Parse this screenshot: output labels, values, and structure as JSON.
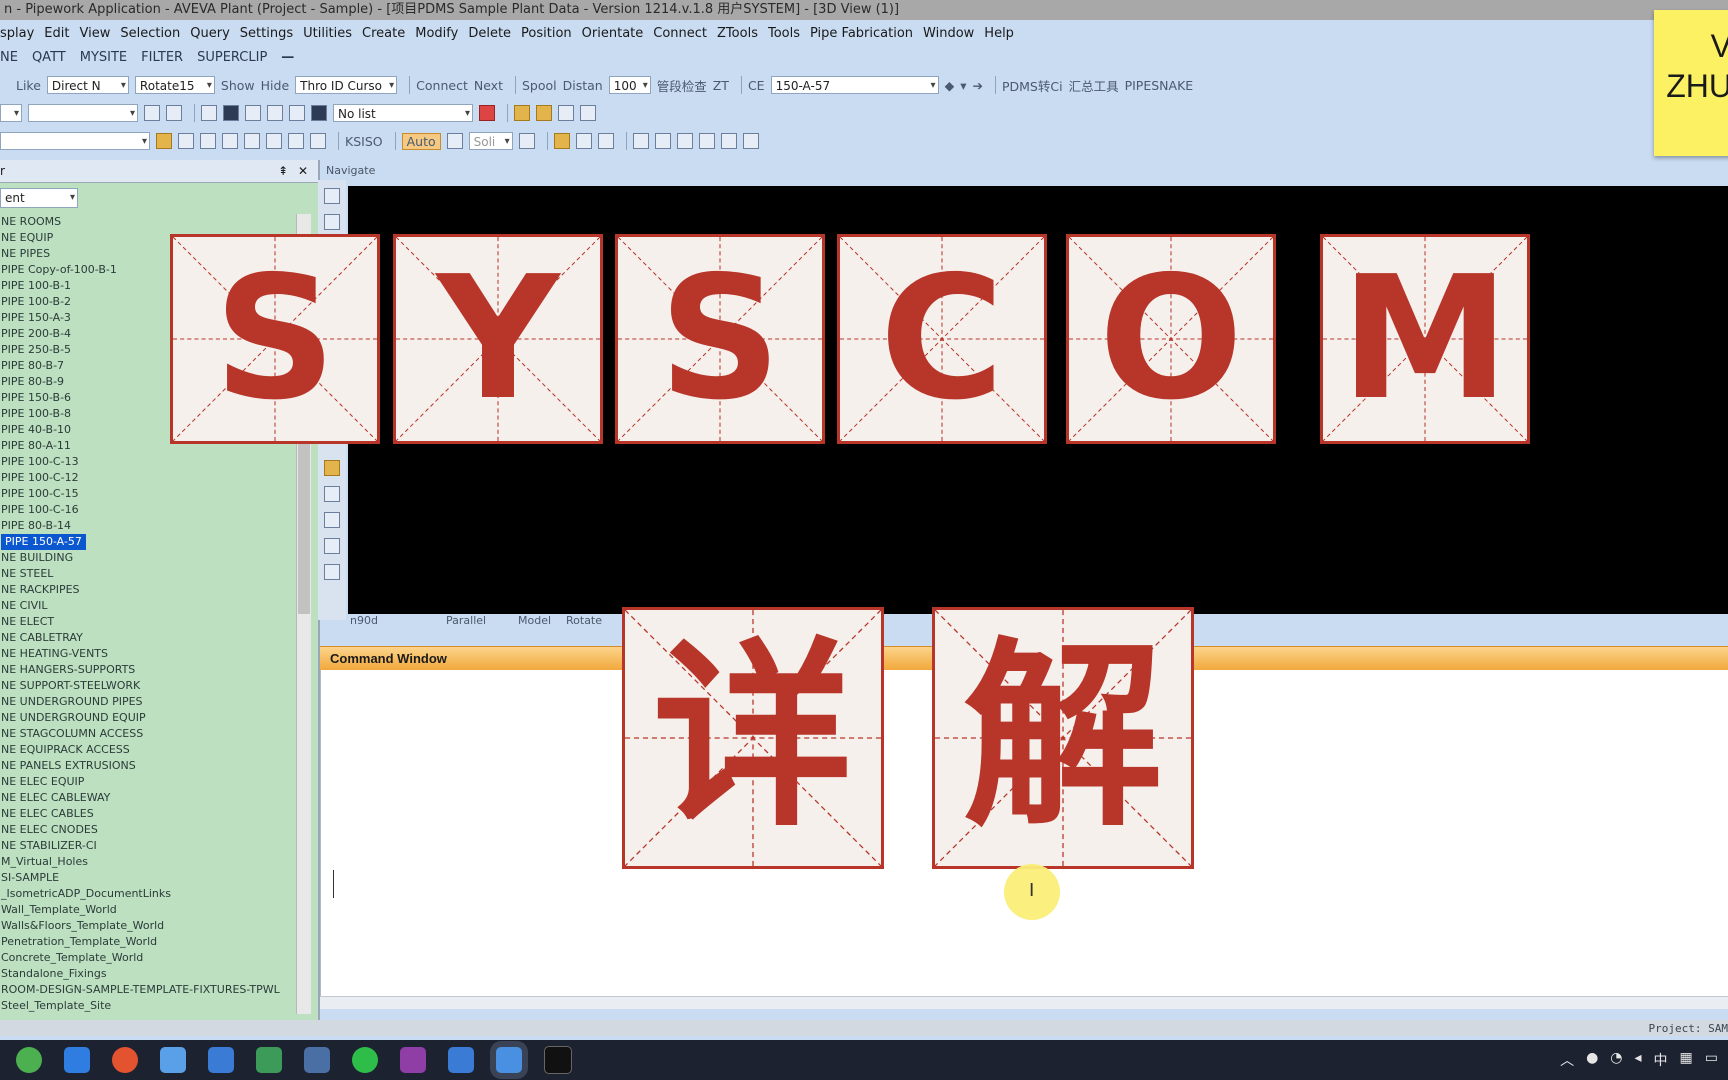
{
  "window": {
    "title": "n - Pipework Application - AVEVA Plant (Project - Sample) - [项目PDMS Sample Plant Data - Version 1214.v.1.8 用户SYSTEM] - [3D View (1)]"
  },
  "menubar": {
    "items": [
      "splay",
      "Edit",
      "View",
      "Selection",
      "Query",
      "Settings",
      "Utilities",
      "Create",
      "Modify",
      "Delete",
      "Position",
      "Orientate",
      "Connect",
      "ZTools",
      "Tools",
      "Pipe Fabrication",
      "Window",
      "Help"
    ]
  },
  "custombar": {
    "items": [
      "NE",
      "QATT",
      "MYSITE",
      "FILTER",
      "SUPERCLIP"
    ]
  },
  "toolbar1": {
    "like": "Like",
    "direct": "Direct N",
    "rotate": "Rotate15",
    "show": "Show",
    "hide": "Hide",
    "thro": "Thro ID Curso",
    "connect": "Connect",
    "next": "Next",
    "spool": "Spool",
    "distan": "Distan",
    "distan_value": "100",
    "cn_label": "管段检查",
    "zt": "ZT",
    "ce": "CE",
    "ce_value": "150-A-57",
    "pdms": "PDMS转Ci",
    "tools_cn": "汇总工具",
    "pipesnake": "PIPESNAKE"
  },
  "toolbar2": {
    "list": "No list"
  },
  "toolbar3": {
    "ksiso": "KSISO",
    "auto": "Auto",
    "soli": "Soli"
  },
  "sticky": {
    "line1": "V",
    "line2": "ZHU"
  },
  "explorer": {
    "combo": "ent",
    "items": [
      "NE ROOMS",
      "NE EQUIP",
      "NE PIPES",
      "PIPE Copy-of-100-B-1",
      "PIPE 100-B-1",
      "PIPE 100-B-2",
      "PIPE 150-A-3",
      "PIPE 200-B-4",
      "PIPE 250-B-5",
      "PIPE 80-B-7",
      "PIPE 80-B-9",
      "PIPE 150-B-6",
      "PIPE 100-B-8",
      "PIPE 40-B-10",
      "PIPE 80-A-11",
      "PIPE 100-C-13",
      "PIPE 100-C-12",
      "PIPE 100-C-15",
      "PIPE 100-C-16",
      "PIPE 80-B-14",
      "PIPE 150-A-57",
      "NE BUILDING",
      "NE STEEL",
      "NE RACKPIPES",
      "NE CIVIL",
      "NE ELECT",
      "NE CABLETRAY",
      "NE HEATING-VENTS",
      "NE HANGERS-SUPPORTS",
      "NE SUPPORT-STEELWORK",
      "NE UNDERGROUND PIPES",
      "NE UNDERGROUND EQUIP",
      "NE STAGCOLUMN ACCESS",
      "NE EQUIPRACK ACCESS",
      "NE PANELS EXTRUSIONS",
      "NE ELEC EQUIP",
      "NE ELEC CABLEWAY",
      "NE ELEC CABLES",
      "NE ELEC CNODES",
      "NE STABILIZER-CI",
      "M_Virtual_Holes",
      "SI-SAMPLE",
      "_IsometricADP_DocumentLinks",
      "Wall_Template_World",
      "Walls&Floors_Template_World",
      "Penetration_Template_World",
      "Concrete_Template_World",
      "Standalone_Fixings",
      "ROOM-DESIGN-SAMPLE-TEMPLATE-FIXTURES-TPWL",
      "Steel_Template_Site"
    ],
    "selected_index": 20
  },
  "navigate_label": "Navigate",
  "view_status": [
    "n90d",
    "Parallel",
    "Model",
    "Rotate"
  ],
  "command_window": {
    "title": "Command Window"
  },
  "statusbar": {
    "project": "Project: SAM"
  },
  "overlay": {
    "top_letters": [
      "S",
      "Y",
      "S",
      "C",
      "O",
      "M"
    ],
    "bottom_chars": [
      "详",
      "解"
    ],
    "tile_color": "#b8352a"
  },
  "tray": {
    "ime": "中"
  }
}
